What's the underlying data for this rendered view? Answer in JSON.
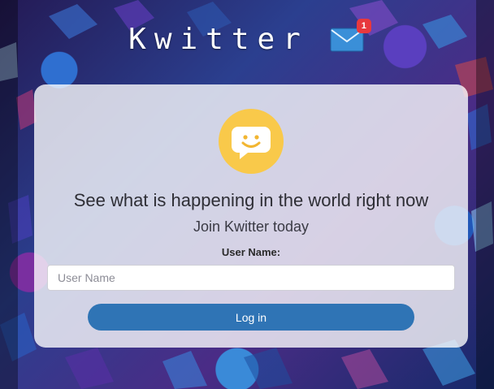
{
  "brand": {
    "title": "Kwitter",
    "notification_count": "1",
    "mail_icon": "mail-icon"
  },
  "card": {
    "logo_icon": "smiley-chat-icon",
    "headline": "See what is happening in the world right now",
    "subline": "Join Kwitter today",
    "username_label": "User Name:",
    "username_placeholder": "User Name",
    "username_value": "",
    "login_label": "Log in"
  },
  "colors": {
    "accent": "#2f74b5",
    "badge": "#e8383d",
    "logo": "#f9c94a"
  }
}
